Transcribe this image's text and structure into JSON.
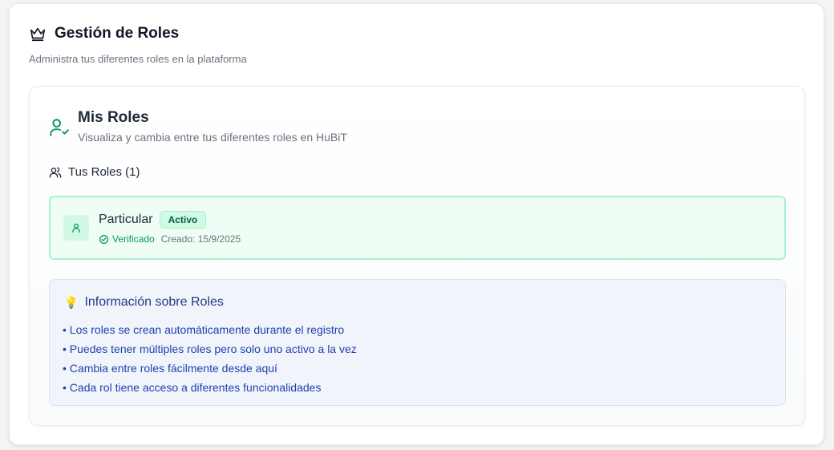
{
  "header": {
    "title": "Gestión de Roles",
    "subtitle": "Administra tus diferentes roles en la plataforma",
    "icon": "crown-icon"
  },
  "my_roles": {
    "title": "Mis Roles",
    "description": "Visualiza y cambia entre tus diferentes roles en HuBiT",
    "icon": "user-check-icon",
    "count_label": "Tus Roles (1)"
  },
  "roles": [
    {
      "name": "Particular",
      "status": "Activo",
      "verified_label": "Verificado",
      "created_label": "Creado: 15/9/2025"
    }
  ],
  "info": {
    "title": "Información sobre Roles",
    "items": [
      "• Los roles se crean automáticamente durante el registro",
      "• Puedes tener múltiples roles pero solo uno activo a la vez",
      "• Cambia entre roles fácilmente desde aquí",
      "• Cada rol tiene acceso a diferentes funcionalidades"
    ]
  },
  "colors": {
    "accent_green": "#059669",
    "active_border": "#a7f3d0",
    "info_text": "#1e40af"
  }
}
